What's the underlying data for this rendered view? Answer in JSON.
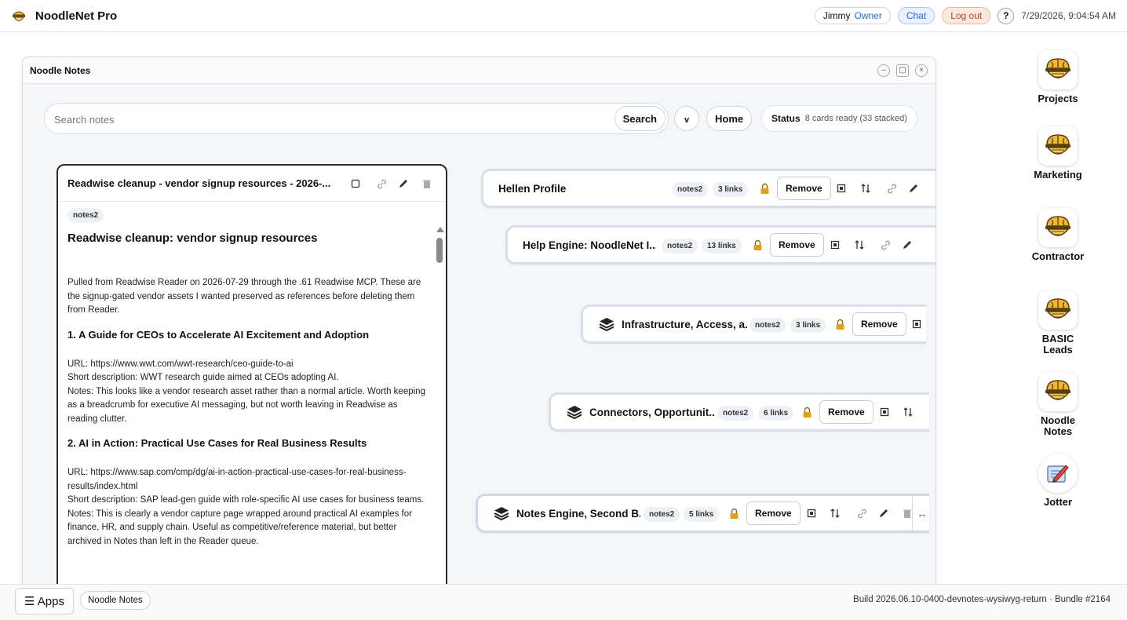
{
  "app": {
    "title": "NoodleNet Pro",
    "user": "Jimmy",
    "role": "Owner",
    "chat_label": "Chat",
    "logout_label": "Log out",
    "help_label": "?",
    "datetime": "7/29/2026, 9:04:54 AM"
  },
  "window": {
    "title": "Noodle Notes",
    "minimize": "–",
    "maximize": "▢",
    "close": "×"
  },
  "toolbar": {
    "search_placeholder": "Search notes",
    "search_label": "Search",
    "chevron_label": "v",
    "home_label": "Home",
    "status_label": "Status",
    "status_text": "8 cards ready (33 stacked)"
  },
  "note": {
    "title": "Readwise cleanup - vendor signup resources - 2026-...",
    "tag": "notes2",
    "heading": "Readwise cleanup: vendor signup resources",
    "intro": "Pulled from Readwise Reader on 2026-07-29 through the .61 Readwise MCP. These are the signup-gated vendor assets I wanted preserved as references before deleting them from Reader.",
    "sections": [
      {
        "heading": "1. A Guide for CEOs to Accelerate AI Excitement and Adoption",
        "url": "URL: https://www.wwt.com/wwt-research/ceo-guide-to-ai",
        "desc": "Short description: WWT research guide aimed at CEOs adopting AI.",
        "notes": "Notes: This looks like a vendor research asset rather than a normal article. Worth keeping as a breadcrumb for executive AI messaging, but not worth leaving in Readwise as reading clutter."
      },
      {
        "heading": "2. AI in Action: Practical Use Cases for Real Business Results",
        "url": "URL: https://www.sap.com/cmp/dg/ai-in-action-practical-use-cases-for-real-business-results/index.html",
        "desc": "Short description: SAP lead-gen guide with role-specific AI use cases for business teams.",
        "notes": "Notes: This is clearly a vendor capture page wrapped around practical AI examples for finance, HR, and supply chain. Useful as competitive/reference material, but better archived in Notes than left in the Reader queue."
      }
    ]
  },
  "cards": [
    {
      "title": "Hellen Profile",
      "tag": "notes2",
      "links": "3 links",
      "remove": "Remove"
    },
    {
      "title": "Help Engine: NoodleNet I...",
      "tag": "notes2",
      "links": "13 links",
      "remove": "Remove"
    },
    {
      "title": "Infrastructure, Access, a...",
      "tag": "notes2",
      "links": "3 links",
      "remove": "Remove"
    },
    {
      "title": "Connectors, Opportunit...",
      "tag": "notes2",
      "links": "6 links",
      "remove": "Remove"
    },
    {
      "title": "Notes Engine, Second B...",
      "tag": "notes2",
      "links": "5 links",
      "remove": "Remove"
    }
  ],
  "desktop": [
    {
      "label": "Projects"
    },
    {
      "label": "Marketing"
    },
    {
      "label": "Contractor"
    },
    {
      "label": "BASIC Leads"
    },
    {
      "label": "Noodle Notes"
    },
    {
      "label": "Jotter"
    }
  ],
  "bottom": {
    "apps_label": "☰ Apps",
    "task_label": "Noodle Notes",
    "build": "Build 2026.06.10-0400-devnotes-wysiwyg-return · Bundle #2164"
  },
  "colors": {
    "accent": "#2b66d6",
    "lock": "#e0a21b",
    "brain": "#f2b632"
  }
}
